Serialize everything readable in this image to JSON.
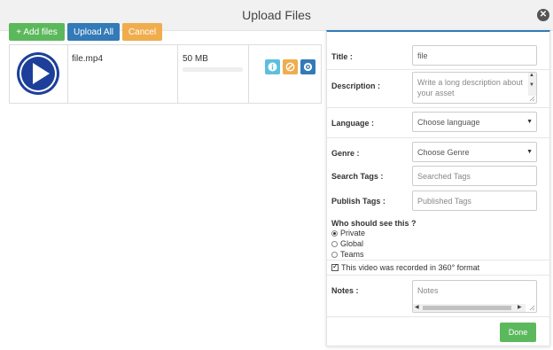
{
  "modal": {
    "title": "Upload Files",
    "close_icon": "close-icon"
  },
  "toolbar": {
    "add_label": "+ Add files",
    "upload_label": "Upload All",
    "cancel_label": "Cancel"
  },
  "file": {
    "name": "file.mp4",
    "size": "50 MB",
    "progress": 0,
    "thumbnail_icon": "play-circle-icon",
    "actions": [
      "info-icon",
      "ban-icon",
      "gear-icon"
    ]
  },
  "panel": {
    "title_label": "Title :",
    "title_value": "file",
    "description_label": "Description :",
    "description_placeholder": "Write a long description about your asset",
    "language_label": "Language :",
    "language_value": "Choose language",
    "genre_label": "Genre :",
    "genre_value": "Choose Genre",
    "search_tags_label": "Search Tags :",
    "search_tags_placeholder": "Searched Tags",
    "publish_tags_label": "Publish Tags :",
    "publish_tags_placeholder": "Published Tags",
    "visibility_title": "Who should see this ?",
    "visibility_options": [
      "Private",
      "Global",
      "Teams"
    ],
    "visibility_selected": "Private",
    "checkbox_label": "This video was recorded in 360° format",
    "checkbox_checked": true,
    "notes_label": "Notes :",
    "notes_placeholder": "Notes",
    "done_label": "Done"
  },
  "colors": {
    "accent": "#337ab7",
    "success": "#5cb85c",
    "warning": "#f0ad4e",
    "info": "#5bc0de"
  }
}
